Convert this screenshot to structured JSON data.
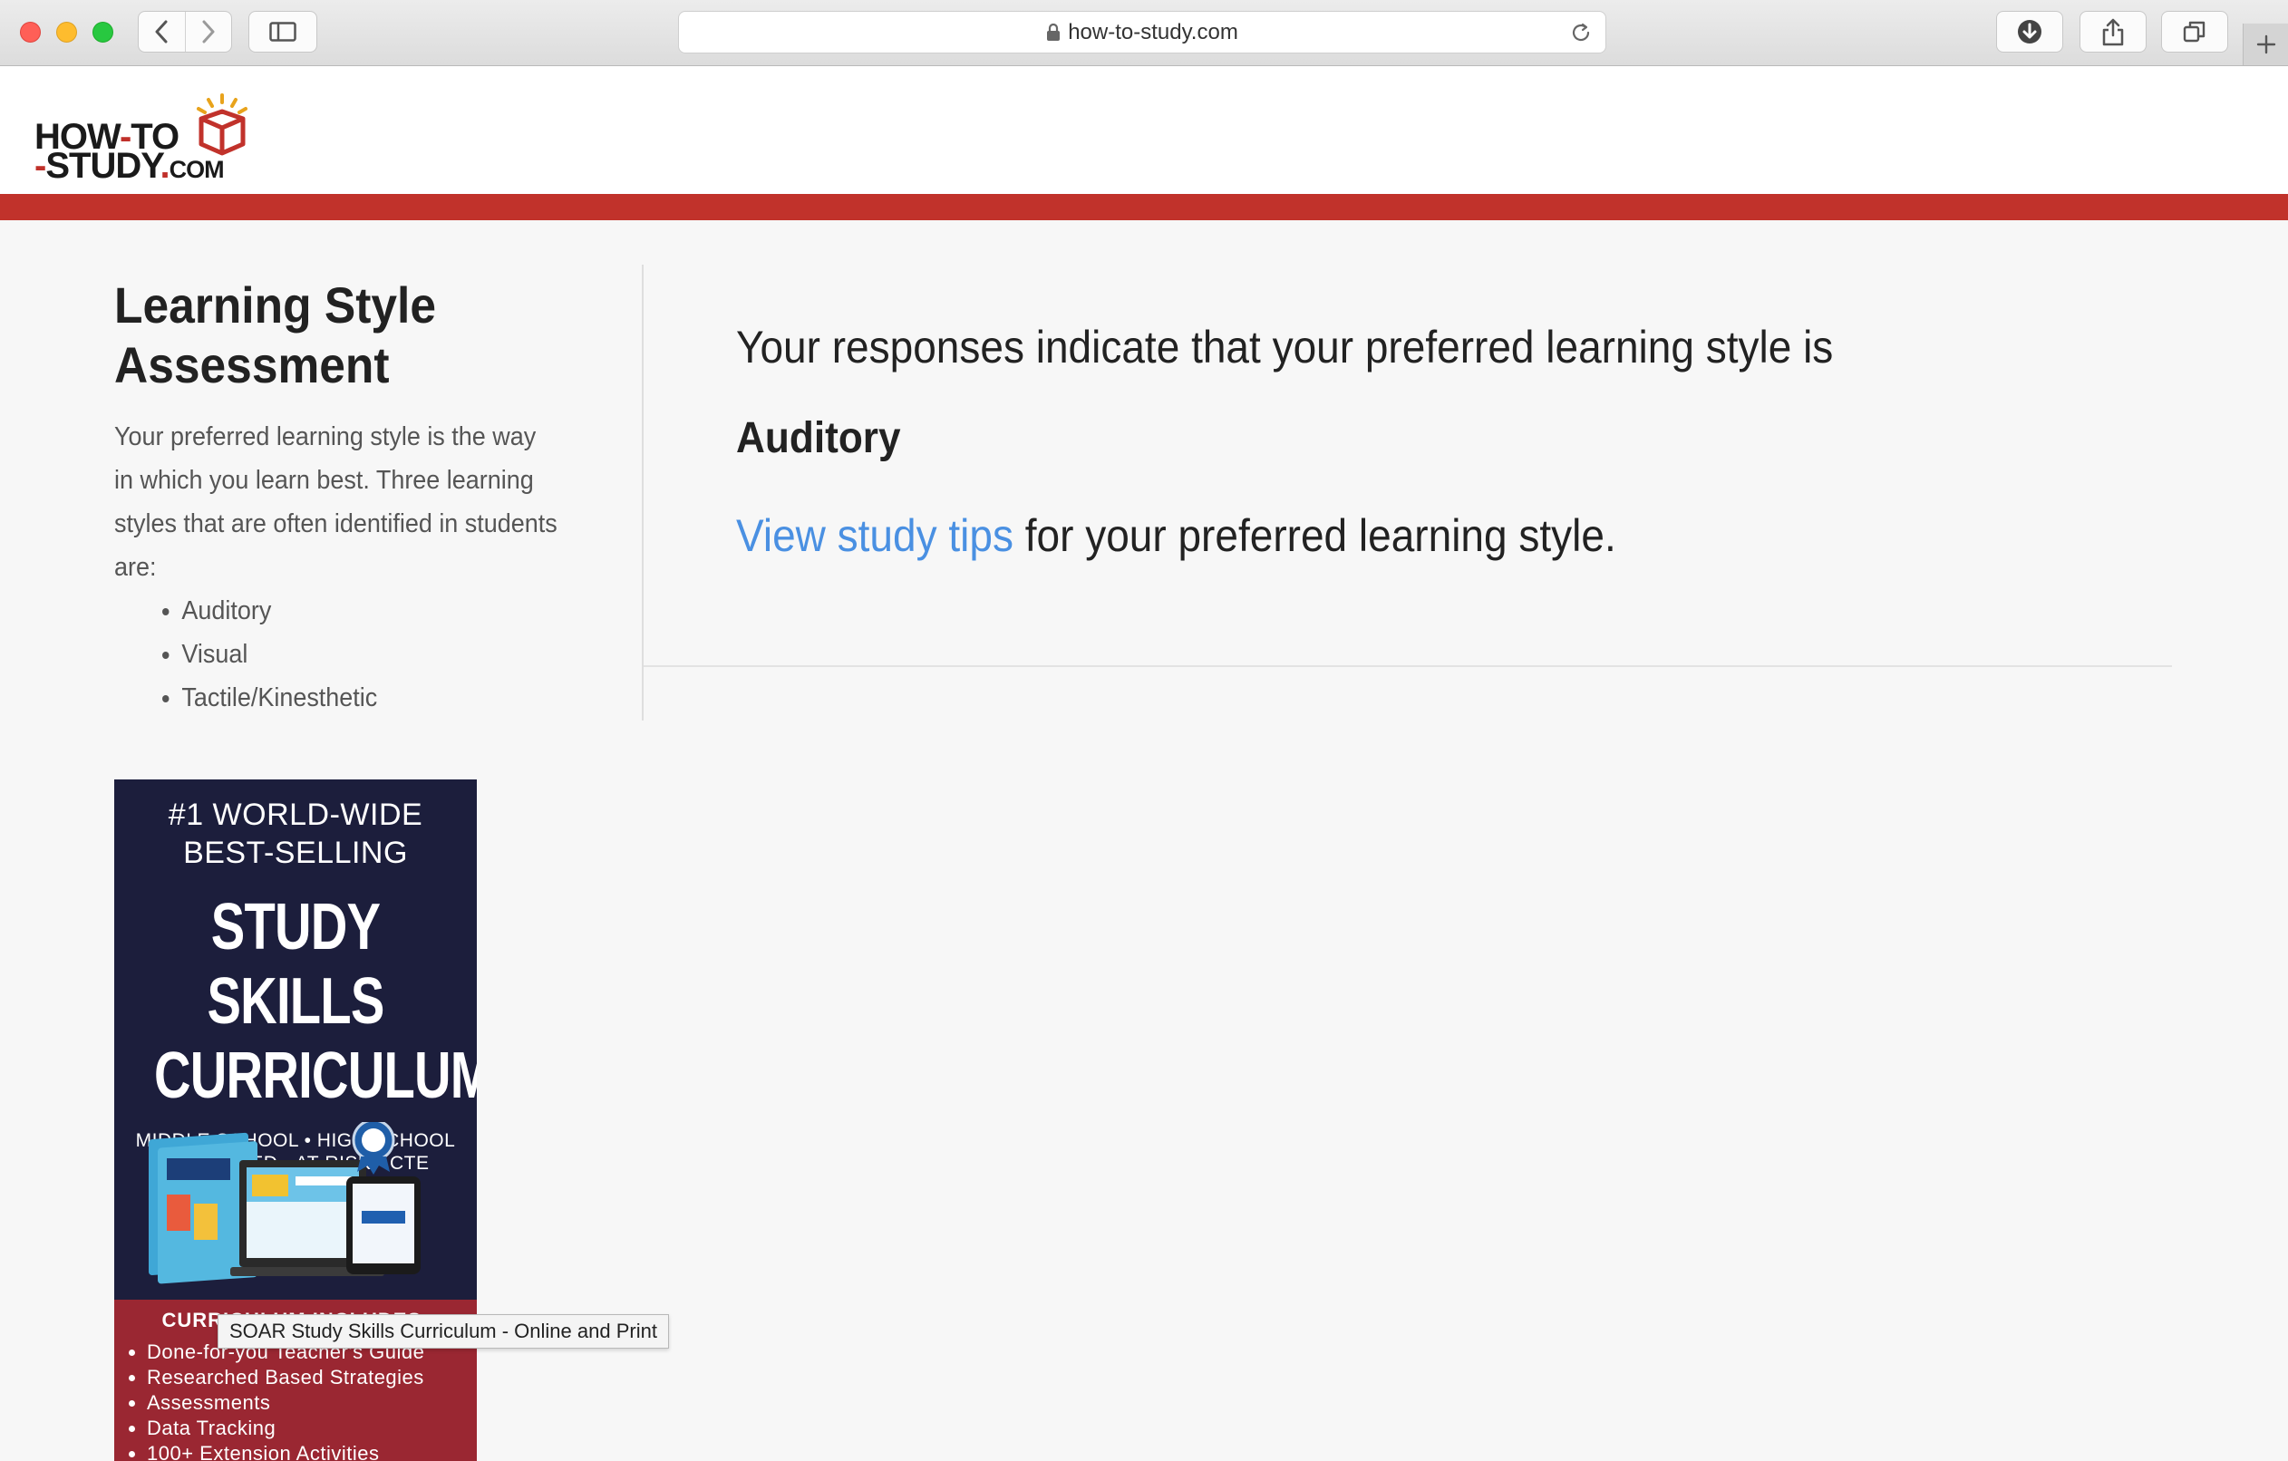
{
  "browser": {
    "url": "how-to-study.com"
  },
  "site": {
    "logo_line1": "HOW",
    "logo_dash1": "-",
    "logo_line1b": "TO",
    "logo_dash2": "-",
    "logo_line2": "STUDY",
    "logo_dot": ".",
    "logo_com": "COM"
  },
  "sidebar": {
    "title": "Learning Style Assessment",
    "description": "Your preferred learning style is the way in which you learn best. Three learning styles that are often identified in students are:",
    "styles": [
      "Auditory",
      "Visual",
      "Tactile/Kinesthetic"
    ]
  },
  "result": {
    "intro": "Your responses indicate that your preferred learning style is",
    "style": "Auditory",
    "link_text": "View study tips",
    "link_suffix": " for your preferred learning style."
  },
  "ad": {
    "tagline_1": "#1 WORLD-WIDE",
    "tagline_2": "BEST-SELLING",
    "title_1": "STUDY SKILLS",
    "title_2": "CURRICULUM",
    "audience_1": "MIDDLE SCHOOL • HIGH SCHOOL",
    "audience_2": "SPECIAL ED • AT-RISK • CTE",
    "includes_heading": "CURRICULUM INCLUDES:",
    "includes": [
      "Done-for-you Teacher's Guide",
      "Researched Based Strategies",
      "Assessments",
      "Data Tracking",
      "100+ Extension Activities"
    ]
  },
  "tooltip": {
    "text": "SOAR Study Skills Curriculum - Online and Print"
  },
  "colors": {
    "brand_red": "#c1322b",
    "link_blue": "#4a90e2",
    "ad_navy": "#1c1e3c",
    "ad_maroon": "#9a2732"
  }
}
